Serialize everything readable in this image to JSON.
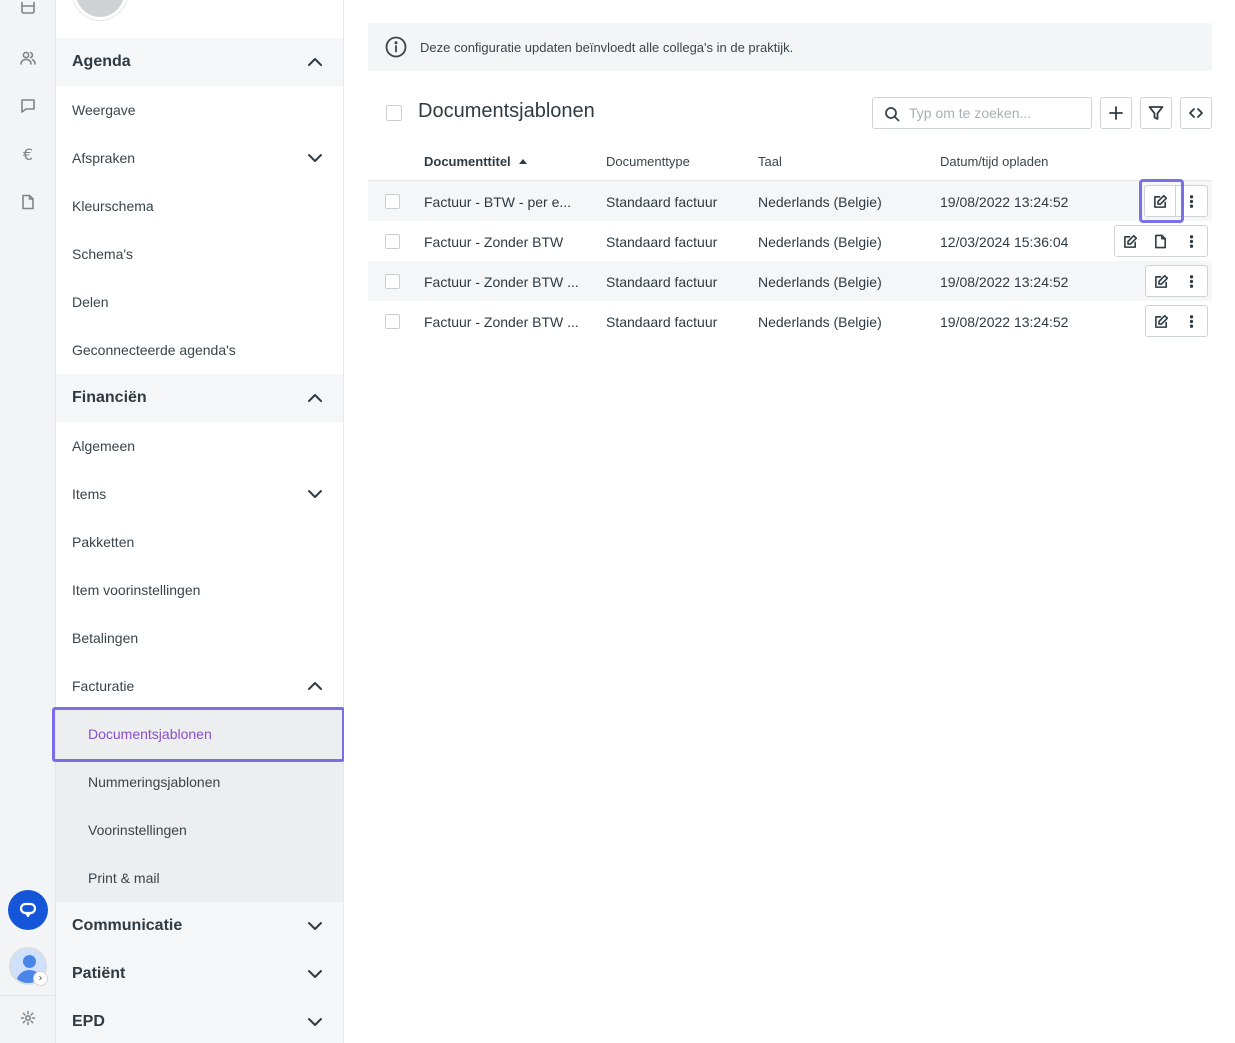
{
  "rail": {
    "icons": [
      "calendar-icon",
      "users-icon",
      "message-icon",
      "euro-icon",
      "document-icon",
      "chat-icon",
      "avatar",
      "settings-icon"
    ],
    "euro_symbol": "€",
    "avatar_badge": "›"
  },
  "sidebar": {
    "sections": {
      "agenda": "Agenda",
      "financien": "Financiën",
      "communicatie": "Communicatie",
      "patient": "Patiënt",
      "epd": "EPD"
    },
    "agenda_items": [
      "Weergave",
      "Afspraken",
      "Kleurschema",
      "Schema's",
      "Delen",
      "Geconnecteerde agenda's"
    ],
    "financien_items": [
      "Algemeen",
      "Items",
      "Pakketten",
      "Item voorinstellingen",
      "Betalingen",
      "Facturatie"
    ],
    "facturatie_items": [
      "Documentsjablonen",
      "Nummeringsjablonen",
      "Voorinstellingen",
      "Print & mail"
    ],
    "active_item": "Documentsjablonen",
    "active_color": "#8a4fcf"
  },
  "main": {
    "notice": "Deze configuratie updaten beïnvloedt alle collega's in de praktijk.",
    "title": "Documentsjablonen",
    "search_placeholder": "Typ om te zoeken...",
    "columns": [
      "Documenttitel",
      "Documenttype",
      "Taal",
      "Datum/tijd opladen"
    ],
    "sort_column": "Documenttitel",
    "rows": [
      {
        "title": "Factuur - BTW - per e...",
        "type": "Standaard factuur",
        "lang": "Nederlands (Belgie)",
        "date": "19/08/2022 13:24:52"
      },
      {
        "title": "Factuur - Zonder BTW",
        "type": "Standaard factuur",
        "lang": "Nederlands (Belgie)",
        "date": "12/03/2024 15:36:04"
      },
      {
        "title": "Factuur - Zonder BTW ...",
        "type": "Standaard factuur",
        "lang": "Nederlands (Belgie)",
        "date": "19/08/2022 13:24:52"
      },
      {
        "title": "Factuur - Zonder BTW ...",
        "type": "Standaard factuur",
        "lang": "Nederlands (Belgie)",
        "date": "19/08/2022 13:24:52"
      }
    ],
    "highlight_color": "#7b6fe8"
  }
}
